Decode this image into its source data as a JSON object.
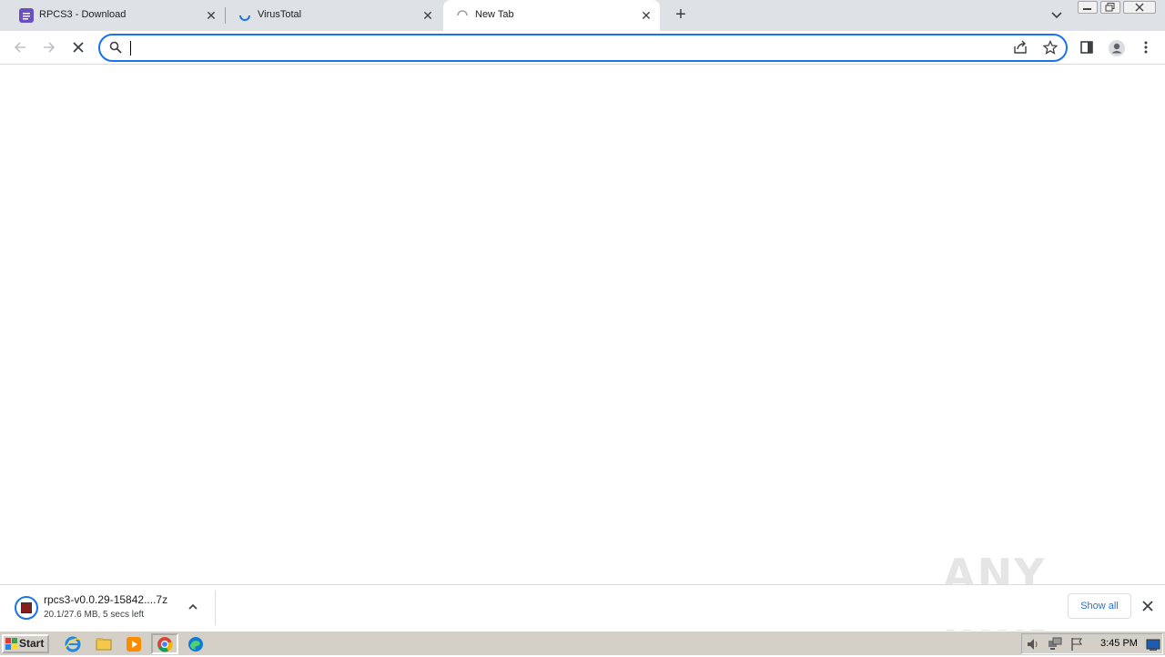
{
  "tabs": [
    {
      "title": "RPCS3 - Download",
      "favicon": "rpcs3-icon"
    },
    {
      "title": "VirusTotal",
      "favicon": "loading-spinner-icon"
    },
    {
      "title": "New Tab",
      "favicon": "loading-spinner-icon",
      "active": true
    }
  ],
  "omnibox": {
    "value": "",
    "placeholder": ""
  },
  "download": {
    "filename": "rpcs3-v0.0.29-15842....7z",
    "status": "20.1/27.6 MB, 5 secs left",
    "show_all_label": "Show all"
  },
  "watermark": "ANY RUN",
  "taskbar": {
    "start_label": "Start",
    "clock": "3:45 PM",
    "apps": [
      "internet-explorer-icon",
      "file-explorer-icon",
      "media-player-icon",
      "chrome-icon",
      "edge-icon"
    ]
  },
  "colors": {
    "accent": "#1a73e8",
    "tabstrip": "#dee1e6",
    "taskbar": "#d4d0c8"
  }
}
